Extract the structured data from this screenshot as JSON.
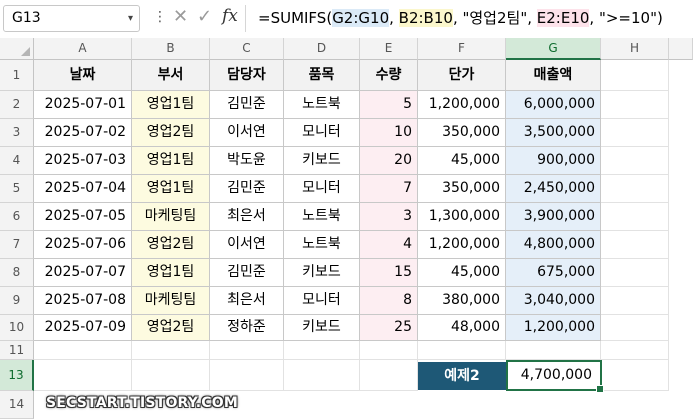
{
  "formula_bar": {
    "name_box": "G13",
    "formula_parts": [
      {
        "text": "=SUMIFS(",
        "hl": ""
      },
      {
        "text": "G2:G10",
        "hl": "a"
      },
      {
        "text": ", ",
        "hl": ""
      },
      {
        "text": "B2:B10",
        "hl": "b"
      },
      {
        "text": ", \"영업2팀\", ",
        "hl": ""
      },
      {
        "text": "E2:E10",
        "hl": "c"
      },
      {
        "text": ", \">=10\")",
        "hl": ""
      }
    ]
  },
  "columns": [
    "A",
    "B",
    "C",
    "D",
    "E",
    "F",
    "G",
    "H"
  ],
  "rows": [
    "1",
    "2",
    "3",
    "4",
    "5",
    "6",
    "7",
    "8",
    "9",
    "10",
    "11",
    "13",
    "14"
  ],
  "table": {
    "headers": [
      "날짜",
      "부서",
      "담당자",
      "품목",
      "수량",
      "단가",
      "매출액"
    ],
    "data": [
      [
        "2025-07-01",
        "영업1팀",
        "김민준",
        "노트북",
        "5",
        "1,200,000",
        "6,000,000"
      ],
      [
        "2025-07-02",
        "영업2팀",
        "이서연",
        "모니터",
        "10",
        "350,000",
        "3,500,000"
      ],
      [
        "2025-07-03",
        "영업1팀",
        "박도윤",
        "키보드",
        "20",
        "45,000",
        "900,000"
      ],
      [
        "2025-07-04",
        "영업1팀",
        "김민준",
        "모니터",
        "7",
        "350,000",
        "2,450,000"
      ],
      [
        "2025-07-05",
        "마케팅팀",
        "최은서",
        "노트북",
        "3",
        "1,300,000",
        "3,900,000"
      ],
      [
        "2025-07-06",
        "영업2팀",
        "이서연",
        "노트북",
        "4",
        "1,200,000",
        "4,800,000"
      ],
      [
        "2025-07-07",
        "영업1팀",
        "김민준",
        "키보드",
        "15",
        "45,000",
        "675,000"
      ],
      [
        "2025-07-08",
        "마케팅팀",
        "최은서",
        "모니터",
        "8",
        "380,000",
        "3,040,000"
      ],
      [
        "2025-07-09",
        "영업2팀",
        "정하준",
        "키보드",
        "25",
        "48,000",
        "1,200,000"
      ]
    ]
  },
  "example": {
    "label": "예제2",
    "value": "4,700,000"
  },
  "watermark": "SECSTART.TISTORY.COM",
  "colors": {
    "accent": "#217346",
    "label_bg": "#1e5876",
    "dept_fill": "#fdfbe0",
    "qty_fill": "#fdeef2",
    "sales_fill": "#e5eff9"
  }
}
